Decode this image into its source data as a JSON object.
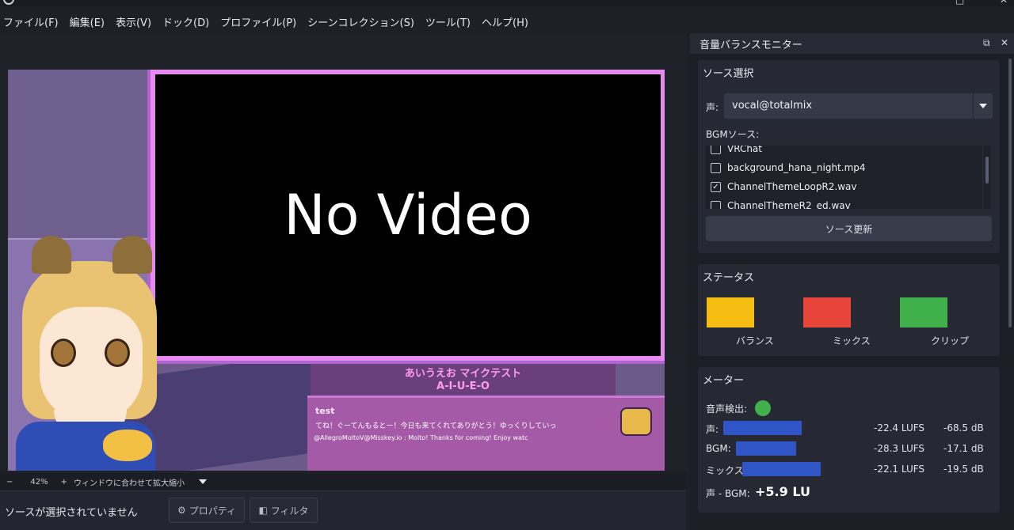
{
  "menubar": {
    "items": [
      "ファイル(F)",
      "編集(E)",
      "表示(V)",
      "ドック(D)",
      "プロファイル(P)",
      "シーンコレクション(S)",
      "ツール(T)",
      "ヘルプ(H)"
    ]
  },
  "preview": {
    "no_video": "No Video",
    "caption_line1": "あいうえお マイクテスト",
    "caption_line2": "A-I-U-E-O",
    "chat_user": "test",
    "chat_message": "てね！ぐーてんもるとー！今日も来てくれてありがとう！ゆっくりしていっ",
    "chat_handle": "@AllegroMoltoV@Misskey.io : Molto! Thanks for coming! Enjoy watc"
  },
  "zoombar": {
    "minus": "−",
    "zoom": "42%",
    "plus": "+",
    "fit_label": "ウィンドウに合わせて拡大縮小"
  },
  "status": {
    "no_source": "ソースが選択されていません",
    "properties_label": "プロパティ",
    "filters_label": "フィルタ"
  },
  "dock": {
    "title": "音量バランスモニター",
    "source_group": {
      "title": "ソース選択",
      "voice_label": "声:",
      "voice_value": "vocal@totalmix",
      "bgm_label": "BGMソース:",
      "bgm_items": [
        {
          "label": "VRChat",
          "checked": false
        },
        {
          "label": "background_hana_night.mp4",
          "checked": false
        },
        {
          "label": "ChannelThemeLoopR2.wav",
          "checked": true
        },
        {
          "label": "ChannelThemeR2_ed.wav",
          "checked": false
        }
      ],
      "refresh_label": "ソース更新"
    },
    "status_group": {
      "title": "ステータス",
      "balance_label": "バランス",
      "mix_label": "ミックス",
      "clip_label": "クリップ",
      "balance_color": "#f5bc12",
      "mix_color": "#e8453a",
      "clip_color": "#3fb04a"
    },
    "meter_group": {
      "title": "メーター",
      "voice_detect_label": "音声検出:",
      "voice_detect_color": "#3fb04a",
      "rows": [
        {
          "label": "声:",
          "lufs": "-22.4 LUFS",
          "db": "-68.5 dB",
          "level": 0.6
        },
        {
          "label": "BGM:",
          "lufs": "-28.3 LUFS",
          "db": "-17.1 dB",
          "level": 0.46
        },
        {
          "label": "ミックス:",
          "lufs": "-22.1 LUFS",
          "db": "-19.5 dB",
          "level": 0.6
        }
      ],
      "diff_label": "声 - BGM:",
      "diff_value": "+5.9 LU"
    }
  },
  "colors": {
    "accent_frame": "#e68af0",
    "meter_bar": "#2f55c7"
  }
}
